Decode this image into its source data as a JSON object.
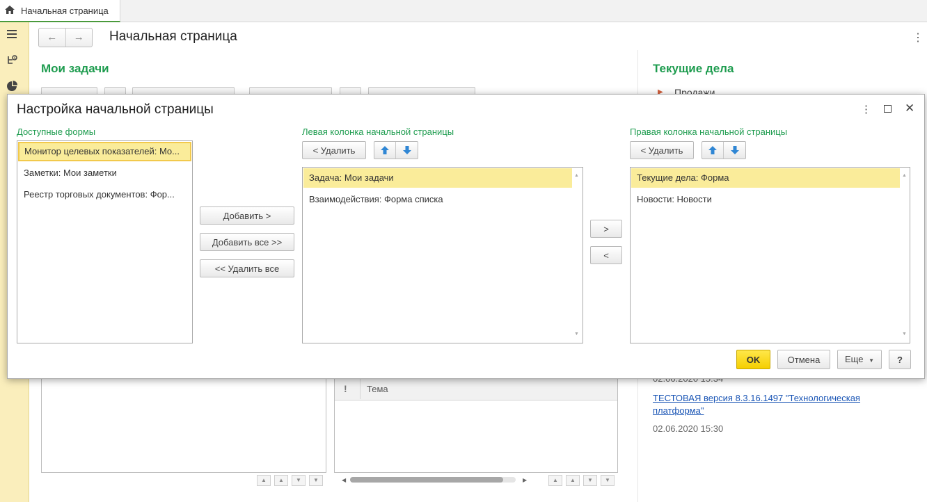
{
  "app": {
    "home_tab_label": "Начальная страница",
    "page_title": "Начальная страница"
  },
  "background": {
    "left_heading": "Мои задачи",
    "right_heading": "Текущие дела",
    "right_first_item": "Продажи",
    "table_column_tema": "Тема",
    "partial_timestamp": "02.06.2020 15:34",
    "news_link": "ТЕСТОВАЯ версия 8.3.16.1497 \"Технологическая платформа\"",
    "news_timestamp": "02.06.2020 15:30"
  },
  "dialog": {
    "title": "Настройка начальной страницы",
    "available": {
      "label": "Доступные формы",
      "items": [
        "Монитор целевых показателей: Мо...",
        "Заметки: Мои заметки",
        "Реестр торговых документов: Фор..."
      ]
    },
    "middle_buttons": {
      "add": "Добавить >",
      "add_all": "Добавить все >>",
      "remove_all": "<< Удалить все"
    },
    "left_column": {
      "label": "Левая колонка начальной страницы",
      "remove": "< Удалить",
      "items": [
        "Задача: Мои задачи",
        "Взаимодействия: Форма списка"
      ]
    },
    "move_buttons": {
      "right": ">",
      "left": "<"
    },
    "right_column": {
      "label": "Правая колонка начальной страницы",
      "remove": "< Удалить",
      "items": [
        "Текущие дела: Форма",
        "Новости: Новости"
      ]
    },
    "footer": {
      "ok": "OK",
      "cancel": "Отмена",
      "more": "Еще",
      "help": "?"
    }
  },
  "colors": {
    "accent_green": "#1e9c4f",
    "selection_yellow": "#faec9a",
    "ok_yellow": "#f5cf00",
    "rail_yellow": "#faeebc",
    "arrow_blue": "#2f86d4"
  }
}
